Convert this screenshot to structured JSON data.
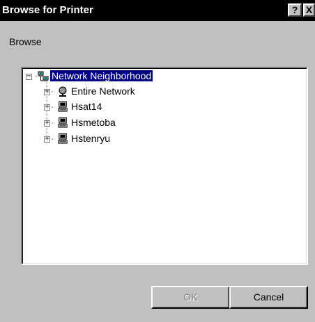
{
  "window": {
    "title": "Browse for Printer",
    "help_button": "?",
    "close_button": "X"
  },
  "browse_label": "Browse",
  "tree": {
    "root": {
      "label": "Network Neighborhood",
      "expander": "−",
      "icon": "network-neighborhood-icon",
      "selected": true
    },
    "children": [
      {
        "label": "Entire Network",
        "expander": "+",
        "icon": "globe-network-icon"
      },
      {
        "label": "Hsat14",
        "expander": "+",
        "icon": "computer-icon"
      },
      {
        "label": "Hsmetoba",
        "expander": "+",
        "icon": "computer-icon"
      },
      {
        "label": "Hstenryu",
        "expander": "+",
        "icon": "computer-icon"
      }
    ]
  },
  "buttons": {
    "ok": "OK",
    "ok_enabled": false,
    "cancel": "Cancel"
  },
  "colors": {
    "titlebar": "#000000",
    "dialog_face": "#c0c0c0",
    "selection": "#000080"
  }
}
